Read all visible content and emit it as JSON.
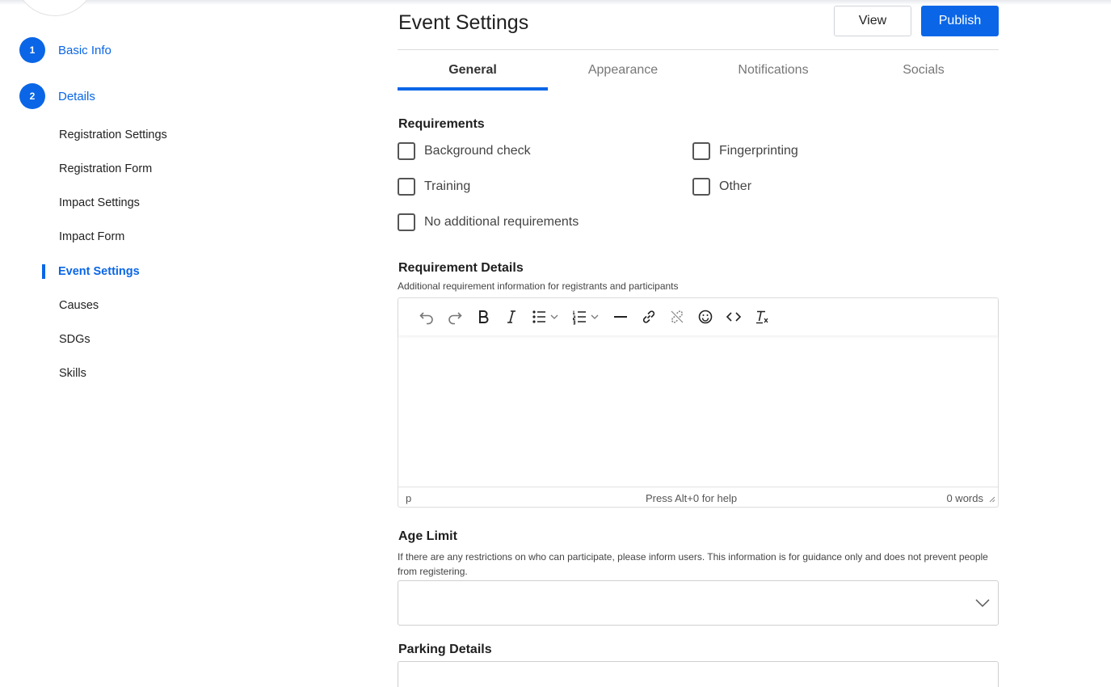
{
  "sidebar": {
    "steps": [
      {
        "number": "1",
        "label": "Basic Info"
      },
      {
        "number": "2",
        "label": "Details"
      }
    ],
    "sub_items": [
      {
        "label": "Registration Settings"
      },
      {
        "label": "Registration Form"
      },
      {
        "label": "Impact Settings"
      },
      {
        "label": "Impact Form"
      },
      {
        "label": "Event Settings",
        "active": true
      },
      {
        "label": "Causes"
      },
      {
        "label": "SDGs"
      },
      {
        "label": "Skills"
      }
    ]
  },
  "header": {
    "title": "Event Settings",
    "view_label": "View",
    "publish_label": "Publish"
  },
  "tabs": [
    {
      "label": "General",
      "active": true
    },
    {
      "label": "Appearance"
    },
    {
      "label": "Notifications"
    },
    {
      "label": "Socials"
    }
  ],
  "requirements": {
    "label": "Requirements",
    "options": [
      {
        "label": "Background check",
        "checked": false
      },
      {
        "label": "Fingerprinting",
        "checked": false
      },
      {
        "label": "Training",
        "checked": false
      },
      {
        "label": "Other",
        "checked": false
      },
      {
        "label": "No additional requirements",
        "checked": false
      }
    ]
  },
  "requirement_details": {
    "label": "Requirement Details",
    "helper": "Additional requirement information for registrants and participants",
    "toolbar_icons": [
      "undo-icon",
      "redo-icon",
      "bold-icon",
      "italic-icon",
      "bullet-list-icon",
      "numbered-list-icon",
      "horizontal-rule-icon",
      "link-icon",
      "unlink-icon",
      "emoji-icon",
      "code-icon",
      "clear-format-icon"
    ],
    "status_path": "p",
    "status_help": "Press Alt+0 for help",
    "status_words": "0 words"
  },
  "age_limit": {
    "label": "Age Limit",
    "helper": "If there are any restrictions on who can participate, please inform users. This information is for guidance only and does not prevent people from registering.",
    "value": ""
  },
  "parking_details": {
    "label": "Parking Details",
    "value": ""
  },
  "colors": {
    "accent": "#0a66e6"
  }
}
